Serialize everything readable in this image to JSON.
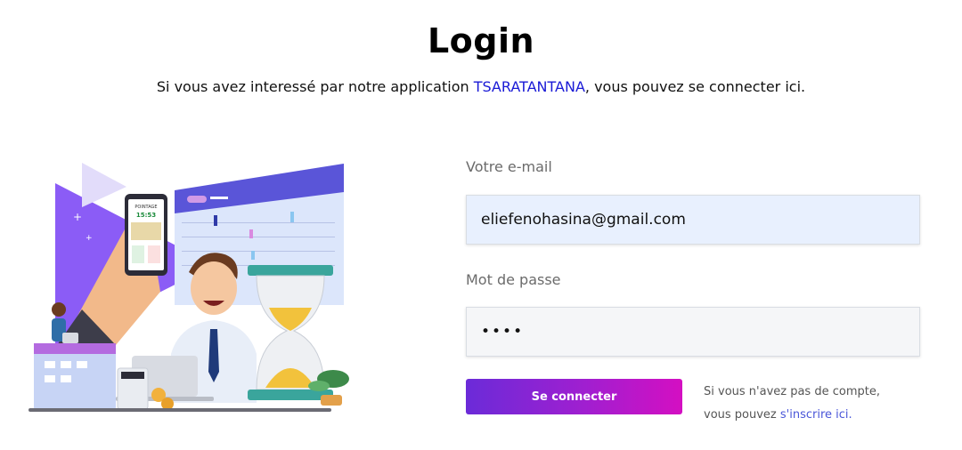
{
  "header": {
    "title": "Login",
    "subtitle_prefix": "Si vous avez interessé par notre application ",
    "brand": "TSARATANTANA",
    "subtitle_suffix": ", vous pouvez se connecter ici."
  },
  "illustration": {
    "phone_app_name": "POINTAGE",
    "phone_time": "15:53"
  },
  "form": {
    "email_label": "Votre e-mail",
    "email_value": "eliefenohasina@gmail.com",
    "password_label": "Mot de passe",
    "password_value": "••••",
    "submit_label": "Se connecter"
  },
  "signup": {
    "line1": "Si vous n'avez pas de compte,",
    "line2_prefix": "vous pouvez ",
    "link": "s'inscrire ici."
  },
  "colors": {
    "brand_link": "#1a1ad6",
    "button_gradient_start": "#6b2bd8",
    "button_gradient_end": "#d40fc2",
    "signup_link": "#4a56d8"
  }
}
